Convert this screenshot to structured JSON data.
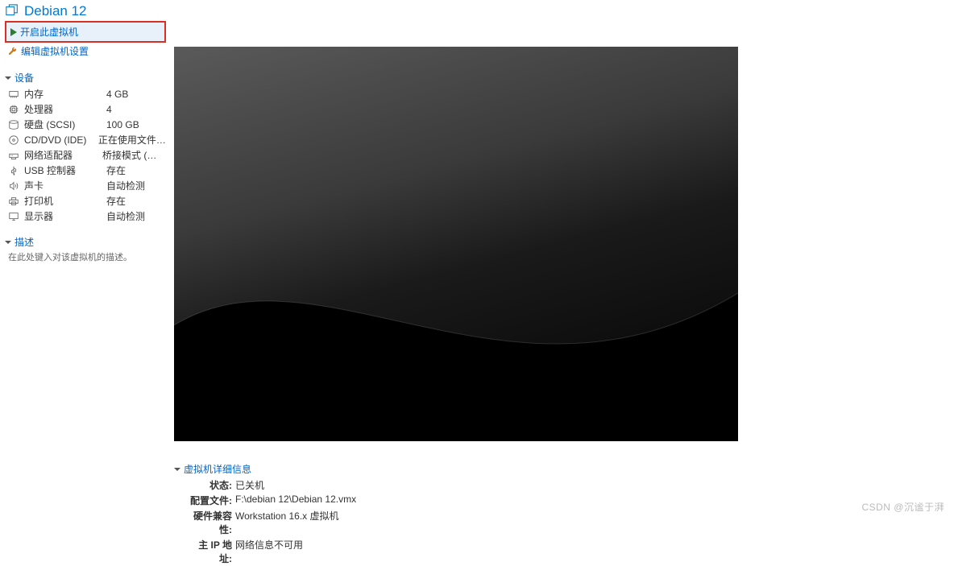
{
  "title": "Debian 12",
  "actions": {
    "power_on": "开启此虚拟机",
    "edit_settings": "编辑虚拟机设置"
  },
  "devices_section_title": "设备",
  "devices": [
    {
      "icon": "memory-icon",
      "label": "内存",
      "value": "4 GB"
    },
    {
      "icon": "cpu-icon",
      "label": "处理器",
      "value": "4"
    },
    {
      "icon": "disk-icon",
      "label": "硬盘 (SCSI)",
      "value": "100 GB"
    },
    {
      "icon": "cd-icon",
      "label": "CD/DVD (IDE)",
      "value": "正在使用文件 H..."
    },
    {
      "icon": "network-icon",
      "label": "网络适配器",
      "value": "桥接模式 (自动)"
    },
    {
      "icon": "usb-icon",
      "label": "USB 控制器",
      "value": "存在"
    },
    {
      "icon": "sound-icon",
      "label": "声卡",
      "value": "自动检测"
    },
    {
      "icon": "printer-icon",
      "label": "打印机",
      "value": "存在"
    },
    {
      "icon": "display-icon",
      "label": "显示器",
      "value": "自动检测"
    }
  ],
  "description_section_title": "描述",
  "description_placeholder": "在此处键入对该虚拟机的描述。",
  "details_section_title": "虚拟机详细信息",
  "details": [
    {
      "label": "状态:",
      "value": "已关机"
    },
    {
      "label": "配置文件:",
      "value": "F:\\debian 12\\Debian 12.vmx"
    },
    {
      "label": "硬件兼容性:",
      "value": "Workstation 16.x 虚拟机"
    },
    {
      "label": "主 IP 地址:",
      "value": "网络信息不可用"
    }
  ],
  "watermark": "CSDN @沉谧于湃"
}
